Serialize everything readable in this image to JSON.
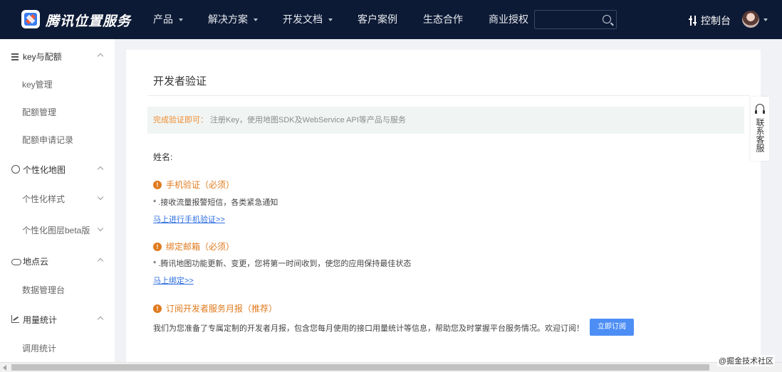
{
  "brand": {
    "name": "腾讯位置服务",
    "logo_icon": "tencent-map-logo"
  },
  "nav": [
    {
      "label": "产品",
      "has_dropdown": true
    },
    {
      "label": "解决方案",
      "has_dropdown": true
    },
    {
      "label": "开发文档",
      "has_dropdown": true
    },
    {
      "label": "客户案例",
      "has_dropdown": false
    },
    {
      "label": "生态合作",
      "has_dropdown": false
    },
    {
      "label": "商业授权",
      "has_dropdown": false
    }
  ],
  "search": {
    "placeholder": "",
    "icon": "search-icon"
  },
  "header": {
    "console_label": "控制台",
    "console_icon": "sliders-icon"
  },
  "sidebar": {
    "groups": [
      {
        "label": "key与配额",
        "icon": "list-icon",
        "items": [
          {
            "label": "key管理"
          },
          {
            "label": "配额管理"
          },
          {
            "label": "配额申请记录"
          }
        ]
      },
      {
        "label": "个性化地图",
        "icon": "palette-icon",
        "items": [
          {
            "label": "个性化样式"
          },
          {
            "label": "个性化图层beta版"
          }
        ]
      },
      {
        "label": "地点云",
        "icon": "cloud-icon",
        "items": [
          {
            "label": "数据管理台"
          }
        ]
      },
      {
        "label": "用量统计",
        "icon": "chart-icon",
        "items": [
          {
            "label": "调用统计"
          }
        ]
      }
    ]
  },
  "main": {
    "title": "开发者验证",
    "notice": {
      "highlight": "完成验证即可：",
      "text": "注册Key，使用地图SDK及WebService API等产品与服务"
    },
    "name_label": "姓名:",
    "sections": [
      {
        "title": "手机验证（必须）",
        "desc": "* .接收流量报警短信，各类紧急通知",
        "link": "马上进行手机验证>>"
      },
      {
        "title": "绑定邮箱（必须）",
        "desc": "* .腾讯地图功能更新、变更，您将第一时间收到，使您的应用保持最佳状态",
        "link": "马上绑定>>"
      },
      {
        "title": "订阅开发者服务月报（推荐）",
        "desc": "我们为您准备了专属定制的开发者月报，包含您每月使用的接口用量统计等信息，帮助您及时掌握平台服务情况。欢迎订阅！",
        "button": "立即订阅"
      }
    ]
  },
  "contact": {
    "label": "联系客服",
    "icon": "headset-icon"
  },
  "watermark": "@掘金技术社区",
  "colors": {
    "topbar": "#0d1a35",
    "accent_orange": "#e07a1d",
    "link_blue": "#2f6fe0",
    "button_blue": "#4d8ef5"
  }
}
